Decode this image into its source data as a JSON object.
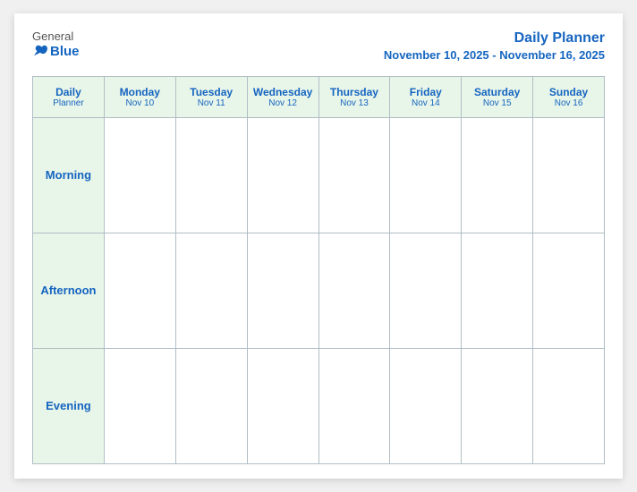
{
  "logo": {
    "general": "General",
    "blue": "Blue",
    "tagline": "GeneralBlue"
  },
  "title": {
    "main": "Daily Planner",
    "dates": "November 10, 2025 - November 16, 2025"
  },
  "table": {
    "header": {
      "col0": {
        "line1": "Daily",
        "line2": "Planner"
      },
      "col1": {
        "line1": "Monday",
        "line2": "Nov 10"
      },
      "col2": {
        "line1": "Tuesday",
        "line2": "Nov 11"
      },
      "col3": {
        "line1": "Wednesday",
        "line2": "Nov 12"
      },
      "col4": {
        "line1": "Thursday",
        "line2": "Nov 13"
      },
      "col5": {
        "line1": "Friday",
        "line2": "Nov 14"
      },
      "col6": {
        "line1": "Saturday",
        "line2": "Nov 15"
      },
      "col7": {
        "line1": "Sunday",
        "line2": "Nov 16"
      }
    },
    "rows": [
      {
        "label": "Morning"
      },
      {
        "label": "Afternoon"
      },
      {
        "label": "Evening"
      }
    ]
  }
}
